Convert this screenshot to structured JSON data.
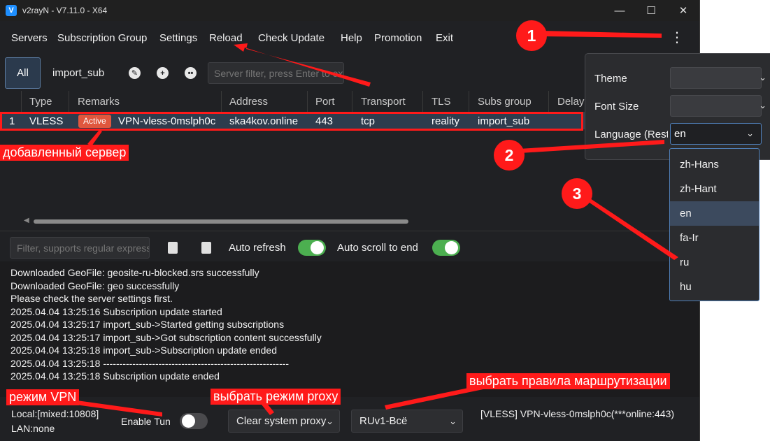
{
  "window": {
    "title": "v2rayN - V7.11.0 - X64",
    "controls": [
      "—",
      "☐",
      "✕"
    ]
  },
  "menu": [
    "Servers",
    "Subscription Group",
    "Settings",
    "Reload",
    "Check Update",
    "Help",
    "Promotion",
    "Exit"
  ],
  "toolbar": {
    "tab_all": "All",
    "tab_sub": "import_sub",
    "filter_placeholder": "Server filter, press Enter to execute"
  },
  "grid": {
    "columns": [
      "Type",
      "Remarks",
      "Address",
      "Port",
      "Transport",
      "TLS",
      "Subs group",
      "Delay"
    ],
    "row": {
      "index": "1",
      "type": "VLESS",
      "badge": "Active",
      "remarks": "VPN-vless-0mslph0c",
      "address": "ska4kov.online",
      "port": "443",
      "transport": "tcp",
      "tls": "reality",
      "subs_group": "import_sub"
    }
  },
  "log_toolbar": {
    "filter_placeholder": "Filter, supports regular expressions",
    "auto_refresh": "Auto refresh",
    "auto_scroll": "Auto scroll to end",
    "auto_refresh_on": true,
    "auto_scroll_on": true
  },
  "log_lines": [
    "Downloaded GeoFile: geosite-ru-blocked.srs successfully",
    "Downloaded GeoFile: geo successfully",
    "Please check the server settings first.",
    "2025.04.04 13:25:16 Subscription update started",
    "2025.04.04 13:25:17 import_sub->Started getting subscriptions",
    "2025.04.04 13:25:17 import_sub->Got subscription content successfully",
    "2025.04.04 13:25:18 import_sub->Subscription update ended",
    "2025.04.04 13:25:18 ---------------------------------------------------------",
    "2025.04.04 13:25:18 Subscription update ended"
  ],
  "status": {
    "local": "Local:[mixed:10808]",
    "lan": "LAN:none",
    "enable_tun": "Enable Tun",
    "tun_on": false,
    "proxy_mode": "Clear system proxy",
    "routing": "RUv1-Всё",
    "current_server": "[VLESS] VPN-vless-0mslph0c(***online:443)"
  },
  "settings_popup": {
    "theme_label": "Theme",
    "font_size_label": "Font Size",
    "language_label": "Language (Restart)",
    "language_value": "en",
    "language_options": [
      "zh-Hans",
      "zh-Hant",
      "en",
      "fa-Ir",
      "ru",
      "hu"
    ],
    "highlighted_option": "en"
  },
  "annotations": {
    "numbers": [
      "1",
      "2",
      "3"
    ],
    "added_server": "добавленный сервер",
    "vpn_mode": "режим VPN",
    "proxy_mode": "выбрать режим proxy",
    "routing_rules": "выбрать правила маршрутизации",
    "color": "#ff1a1a"
  }
}
